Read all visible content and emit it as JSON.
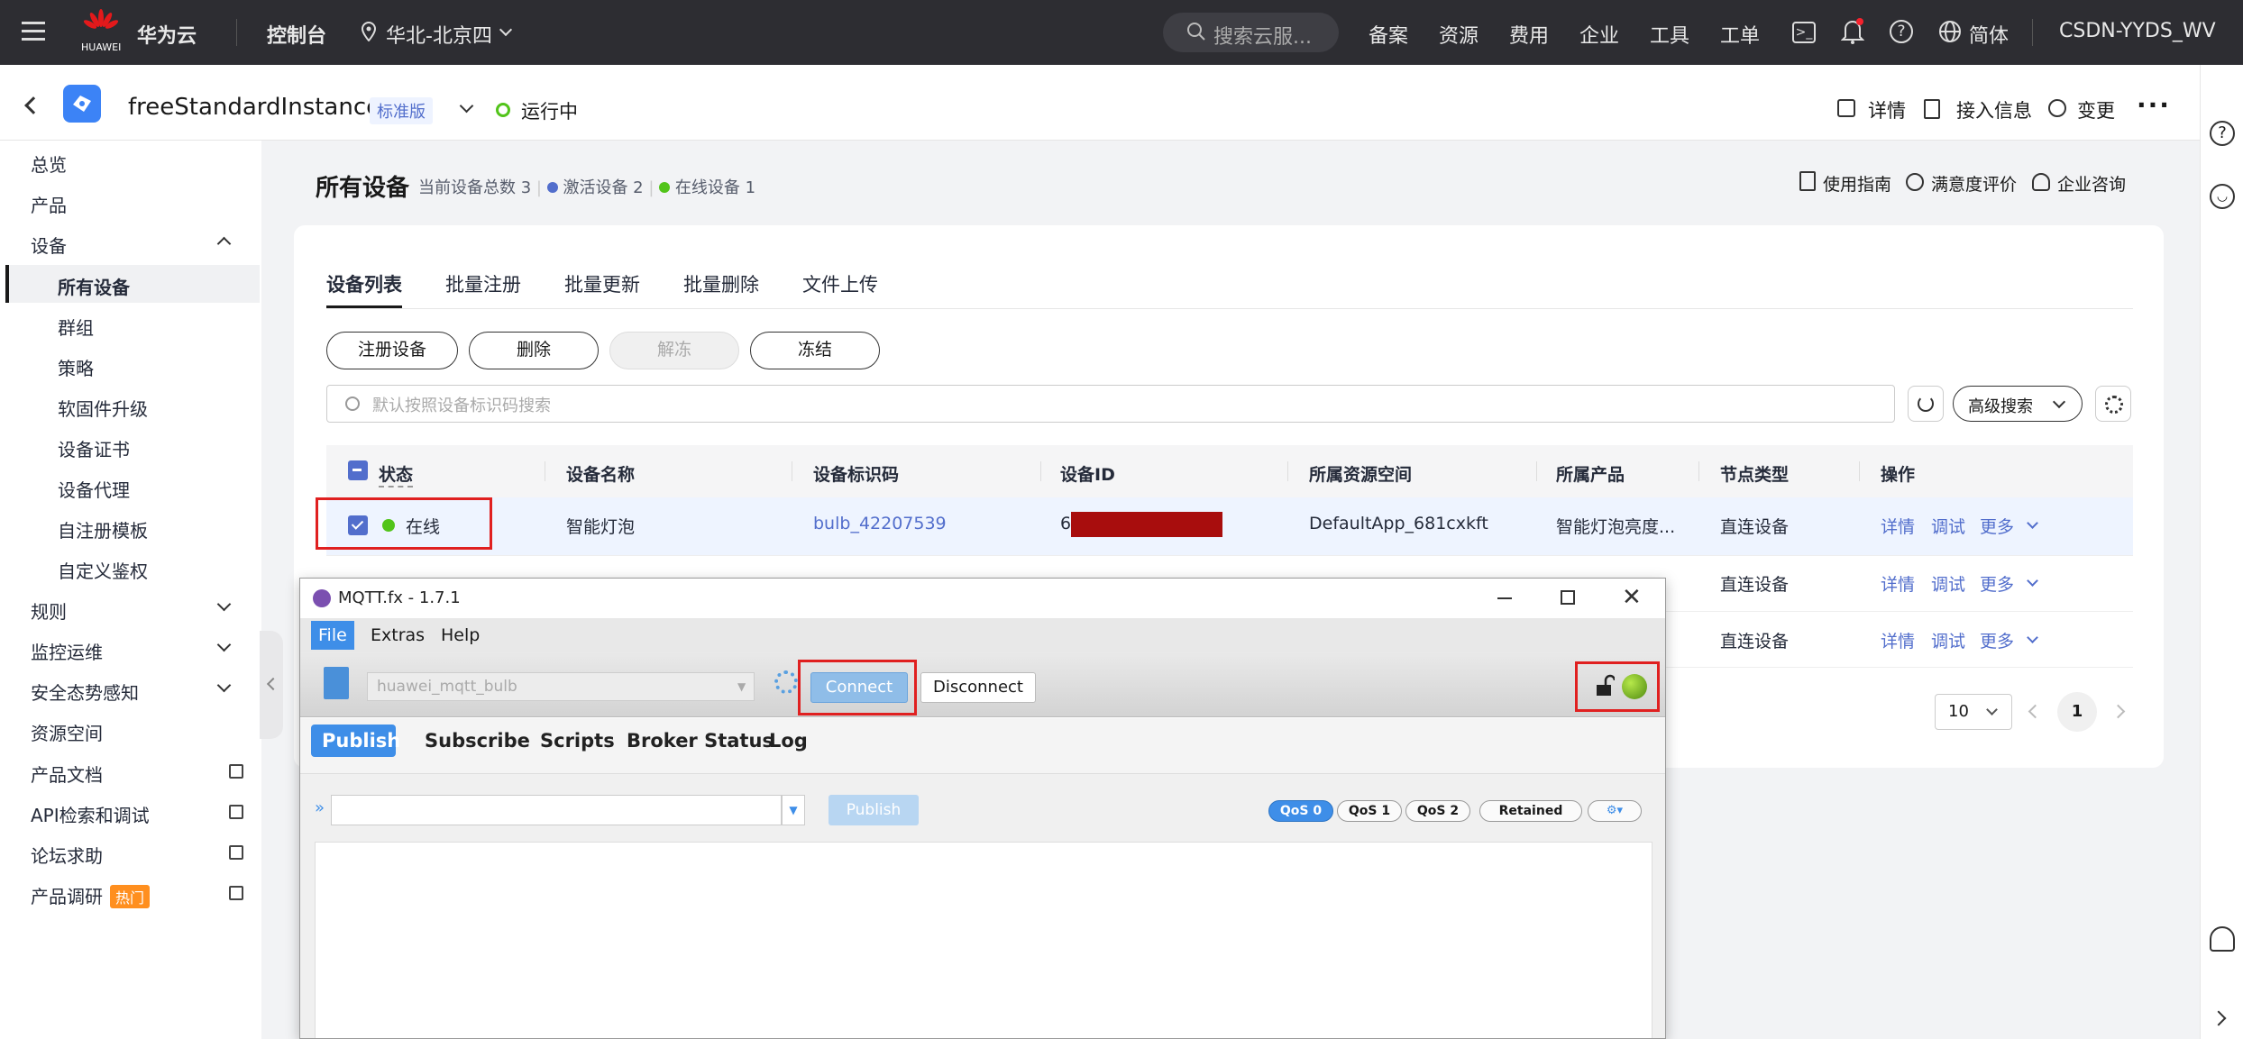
{
  "topbar": {
    "brand_sub": "HUAWEI",
    "brand": "华为云",
    "console": "控制台",
    "region": "华北-北京四",
    "search_placeholder": "搜索云服...",
    "items": [
      "备案",
      "资源",
      "费用",
      "企业",
      "工具",
      "工单"
    ],
    "language": "简体",
    "user": "CSDN-YYDS_WV"
  },
  "header": {
    "instance": "freeStandardInstance",
    "edition": "标准版",
    "status": "运行中",
    "actions": [
      "详情",
      "接入信息",
      "变更"
    ]
  },
  "sidebar": {
    "items": [
      {
        "label": "总览"
      },
      {
        "label": "产品"
      },
      {
        "label": "设备"
      },
      {
        "label": "所有设备"
      },
      {
        "label": "群组"
      },
      {
        "label": "策略"
      },
      {
        "label": "软固件升级"
      },
      {
        "label": "设备证书"
      },
      {
        "label": "设备代理"
      },
      {
        "label": "自注册模板"
      },
      {
        "label": "自定义鉴权"
      },
      {
        "label": "规则"
      },
      {
        "label": "监控运维"
      },
      {
        "label": "安全态势感知"
      },
      {
        "label": "资源空间"
      },
      {
        "label": "产品文档"
      },
      {
        "label": "API检索和调试"
      },
      {
        "label": "论坛求助"
      },
      {
        "label": "产品调研"
      }
    ],
    "hot_badge": "热门"
  },
  "page": {
    "title": "所有设备",
    "summary_total": "当前设备总数 3",
    "summary_active": "激活设备 2",
    "summary_online": "在线设备 1",
    "links": [
      "使用指南",
      "满意度评价",
      "企业咨询"
    ],
    "tabs": [
      "设备列表",
      "批量注册",
      "批量更新",
      "批量删除",
      "文件上传"
    ],
    "buttons": [
      "注册设备",
      "删除",
      "解冻",
      "冻结"
    ],
    "search_placeholder": "默认按照设备标识码搜索",
    "advanced_search": "高级搜索",
    "columns": [
      "状态",
      "设备名称",
      "设备标识码",
      "设备ID",
      "所属资源空间",
      "所属产品",
      "节点类型",
      "操作"
    ],
    "row": {
      "status": "在线",
      "name": "智能灯泡",
      "code": "bulb_42207539",
      "id_prefix": "6",
      "space": "DefaultApp_681cxkft",
      "product": "智能灯泡亮度...",
      "node": "直连设备"
    },
    "node_type": "直连设备",
    "ops": [
      "详情",
      "调试",
      "更多"
    ],
    "page_size": "10",
    "current_page": "1"
  },
  "mqtt": {
    "title": "MQTT.fx - 1.7.1",
    "menu": [
      "File",
      "Extras",
      "Help"
    ],
    "profile": "huawei_mqtt_bulb",
    "connect": "Connect",
    "disconnect": "Disconnect",
    "tabs": [
      "Publish",
      "Subscribe",
      "Scripts",
      "Broker Status",
      "Log"
    ],
    "publish_btn": "Publish",
    "qos": [
      "QoS 0",
      "QoS 1",
      "QoS 2"
    ],
    "retained": "Retained"
  },
  "colors": {
    "accent": "#526ecc",
    "online": "#52c41a",
    "highlight": "#e02020",
    "mqtt_blue": "#4a98e0"
  }
}
